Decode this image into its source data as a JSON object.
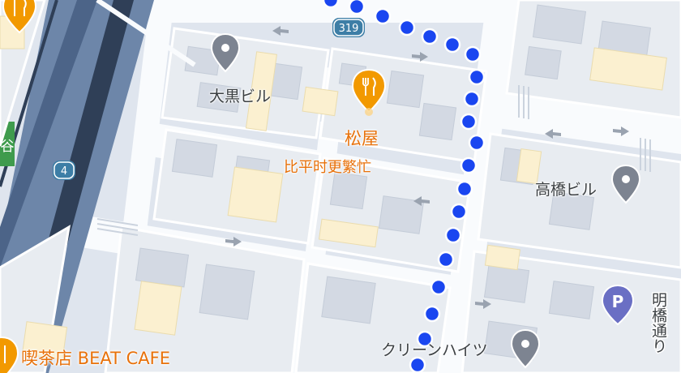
{
  "map": {
    "route_shields": [
      "319",
      "4"
    ],
    "station_label": "谷",
    "pois": [
      {
        "name": "大黒ビル",
        "icon": "location-pin-icon"
      },
      {
        "name": "松屋",
        "subtitle": "比平时更繁忙",
        "icon": "restaurant-icon"
      },
      {
        "name": "高橋ビル",
        "icon": "location-pin-icon"
      },
      {
        "name": "クリーンハイツ",
        "icon": "location-pin-icon"
      },
      {
        "name": "喫茶店 BEAT CAFE",
        "icon": "restaurant-icon"
      }
    ],
    "street_label": "明橋通り",
    "parking_icon": "P",
    "route": {
      "color": "#1a46f0",
      "style": "dotted"
    },
    "colors": {
      "restaurant": "#f29900",
      "pin": "#7d8491",
      "parking": "#6a6fc4",
      "road": "#f9fbfd",
      "block": "#e8ecf1",
      "building": "#d3d9e3",
      "highlight_building": "#fbf0d0",
      "water": "#6d86a9"
    }
  }
}
